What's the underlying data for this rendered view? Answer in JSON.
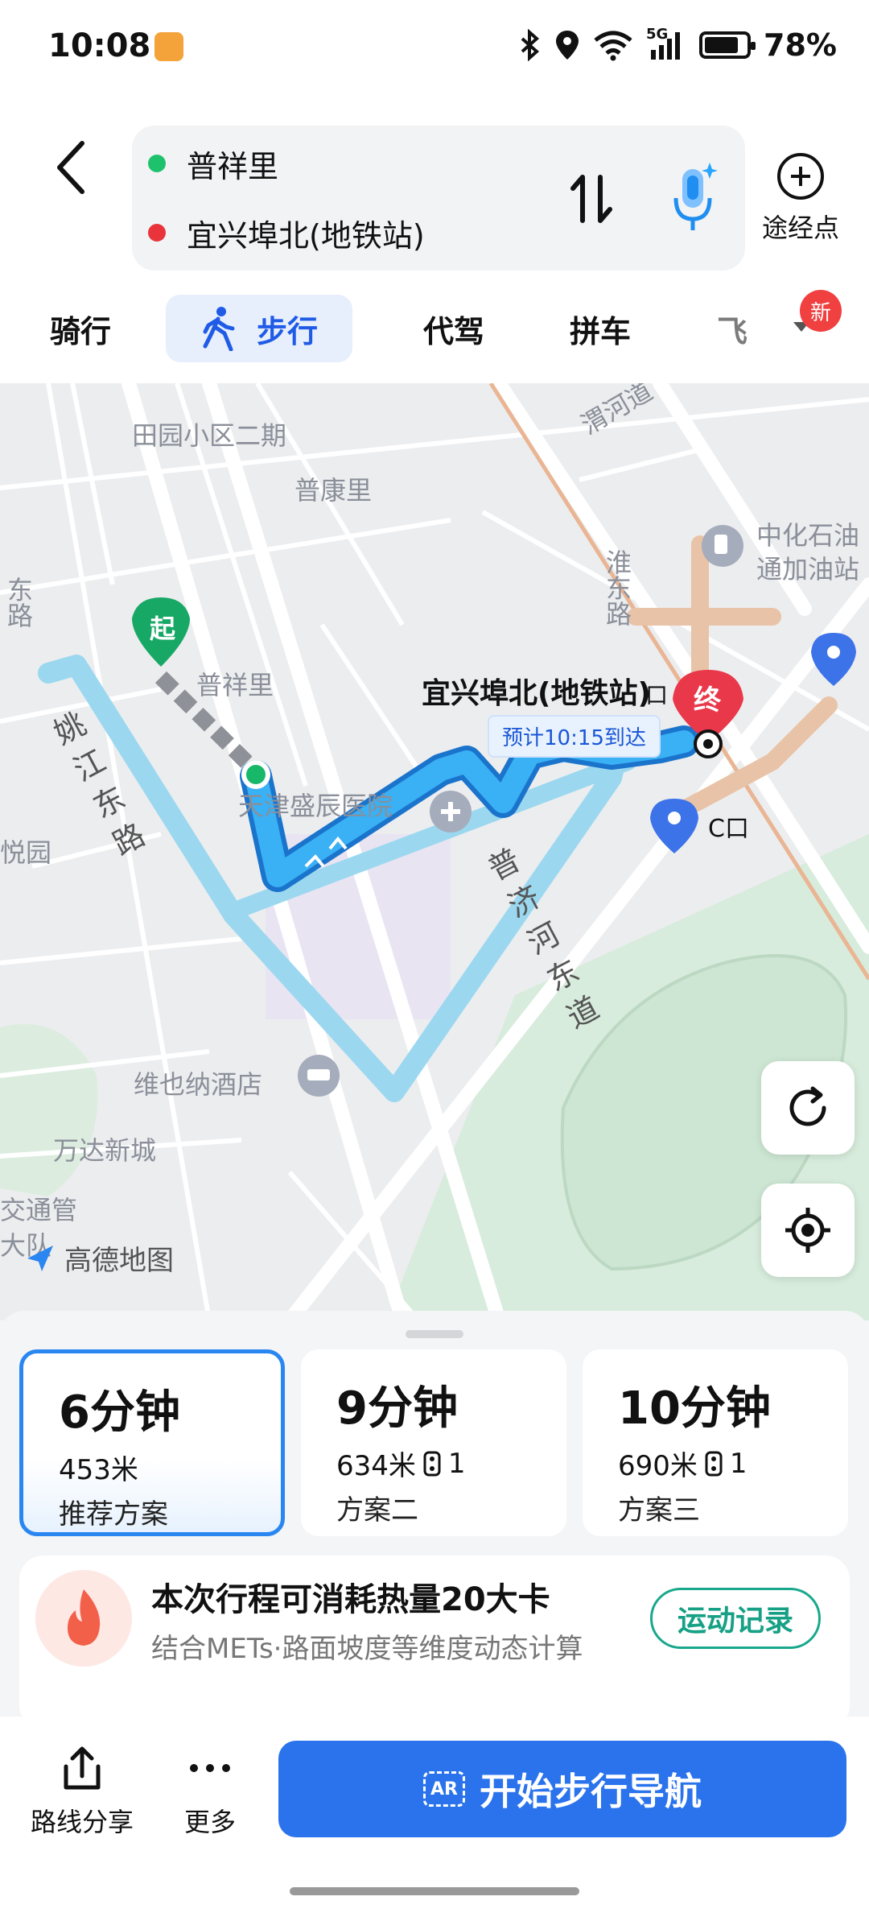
{
  "status_bar": {
    "time": "10:08",
    "battery": "78%",
    "network": "5G"
  },
  "header": {
    "origin": "普祥里",
    "destination": "宜兴埠北(地铁站)",
    "waypoint_label": "途经点",
    "colors": {
      "origin_dot": "#1ec26d",
      "destination_dot": "#e8343a"
    }
  },
  "tabs": [
    {
      "label": "骑行",
      "active": false
    },
    {
      "label": "步行",
      "active": true
    },
    {
      "label": "代驾",
      "active": false
    },
    {
      "label": "拼车",
      "active": false
    },
    {
      "label": "飞",
      "active": false
    }
  ],
  "tabs_new_badge": "新",
  "map": {
    "labels": {
      "tianyuan": "田园小区二期",
      "pukang": "普康里",
      "weihe": "渭河道",
      "sinopec1": "中化石油",
      "sinopec2": "通加油站",
      "huaidong": "淮东路",
      "dongroad": "东路",
      "start_marker": "起",
      "puxiangli": "普祥里",
      "yixing": "宜兴埠北(地铁站)",
      "end_marker": "终",
      "eta": "预计10:15到达",
      "yaojiang": "姚江东路",
      "hospital": "天津盛辰医院",
      "puji": "普济河东道",
      "exit_c": "C口",
      "exit_b": "口",
      "yuelyuan": "悦园",
      "vienna": "维也纳酒店",
      "wanda": "万达新城",
      "jiaotong1": "交通管",
      "jiaotong2": "大队"
    },
    "logo": "高德地图"
  },
  "plans": [
    {
      "time": "6分钟",
      "distance": "453米",
      "lights": "",
      "name": "推荐方案",
      "selected": true
    },
    {
      "time": "9分钟",
      "distance": "634米",
      "lights": "1",
      "name": "方案二",
      "selected": false
    },
    {
      "time": "10分钟",
      "distance": "690米",
      "lights": "1",
      "name": "方案三",
      "selected": false
    }
  ],
  "calorie": {
    "title": "本次行程可消耗热量20大卡",
    "subtitle": "结合METs·路面坡度等维度动态计算",
    "button": "运动记录"
  },
  "actions": {
    "share": "路线分享",
    "more": "更多",
    "start": "开始步行导航",
    "ar": "AR"
  },
  "accent": "#2a73ec"
}
